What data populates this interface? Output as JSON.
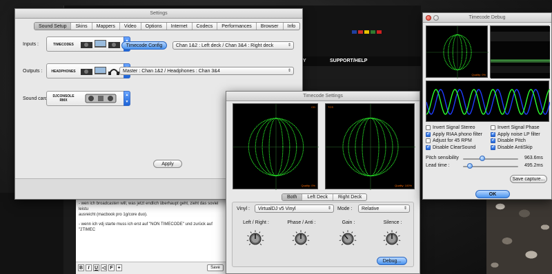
{
  "website": {
    "nav_item": "SUPPORT/HELP",
    "nav_partial": "NY",
    "flag_colors": [
      "#1f3fa0",
      "#cc2a2a",
      "#e8c000",
      "#2f7a2f",
      "#d02020"
    ],
    "editor_lines": [
      "- wen ich broadcasten will, was jetzt endlich überhaupt geht, zieht das soviel leistu",
      "ausreicht (macbook pro 1g/core duo).",
      "- wenn ich vdj starte muss ich erst auf \"NON TIMECODE\" und zurück auf \"2TIMEC"
    ],
    "toolbar_buttons": [
      "B",
      "I",
      "U",
      "◁",
      "F",
      "+"
    ],
    "save_label": "Save"
  },
  "settings": {
    "title": "Settings",
    "tabs": [
      "Sound Setup",
      "Skins",
      "Mappers",
      "Video",
      "Options",
      "Internet",
      "Codecs",
      "Performances",
      "Browser",
      "Info"
    ],
    "active_tab": "Sound Setup",
    "inputs_label": "Inputs :",
    "inputs_device": "TIMECODES",
    "timecode_config": "Timecode Config",
    "inputs_select": "Chan 1&2 : Left deck / Chan 3&4 : Right deck",
    "outputs_label": "Outputs :",
    "outputs_device": "HEADPHONES",
    "outputs_select": "Master : Chan 1&2 / Headphones : Chan 3&4",
    "soundcard_label": "Sound card :",
    "soundcard_device": "DJCONSOLE RMX",
    "apply": "Apply"
  },
  "timecode_settings": {
    "title": "Timecode Settings",
    "scope_left_tag": "CD",
    "scope_right_tag": "TCS",
    "scope_left_quality": "Quality: 0%",
    "scope_right_quality": "Quality: 100%",
    "deck_tabs": [
      "Both",
      "Left Deck",
      "Right Deck"
    ],
    "active_deck_tab": "Both",
    "vinyl_label": "Vinyl :",
    "vinyl_value": "VirtualDJ v5 Vinyl",
    "mode_label": "Mode :",
    "mode_value": "Relative",
    "knobs": [
      {
        "label": "Left / Right :",
        "value": 0.5
      },
      {
        "label": "Phase / Anti :",
        "value": 0.5
      },
      {
        "label": "Gain :",
        "value": 0.35
      },
      {
        "label": "Silence :",
        "value": 0.5
      }
    ],
    "debug": "Debug..."
  },
  "timecode_debug": {
    "title": "Timecode Debug",
    "quality": "Quality: 0%",
    "checkboxes": [
      {
        "label": "Invert Signal Stereo",
        "checked": false
      },
      {
        "label": "Invert Signal Phase",
        "checked": false
      },
      {
        "label": "Apply RIAA phono filter",
        "checked": true
      },
      {
        "label": "Apply noise LP filter",
        "checked": true
      },
      {
        "label": "Adjust for 45 RPM",
        "checked": false
      },
      {
        "label": "Disable Pitch",
        "checked": true
      },
      {
        "label": "Disable ClearSound",
        "checked": true
      },
      {
        "label": "Disable AntiSkip",
        "checked": true
      }
    ],
    "pitch_label": "Pitch sensibility",
    "pitch_value": "963.6ms",
    "pitch_level": 0.35,
    "lead_label": "Lead time :",
    "lead_value": "495.2ms",
    "lead_level": 0.12,
    "save_capture": "Save capture...",
    "ok": "OK"
  },
  "colors": {
    "scope_green": "#2cff2c",
    "accent_blue": "#2f7be8",
    "wave_blue": "#1f3cff"
  }
}
